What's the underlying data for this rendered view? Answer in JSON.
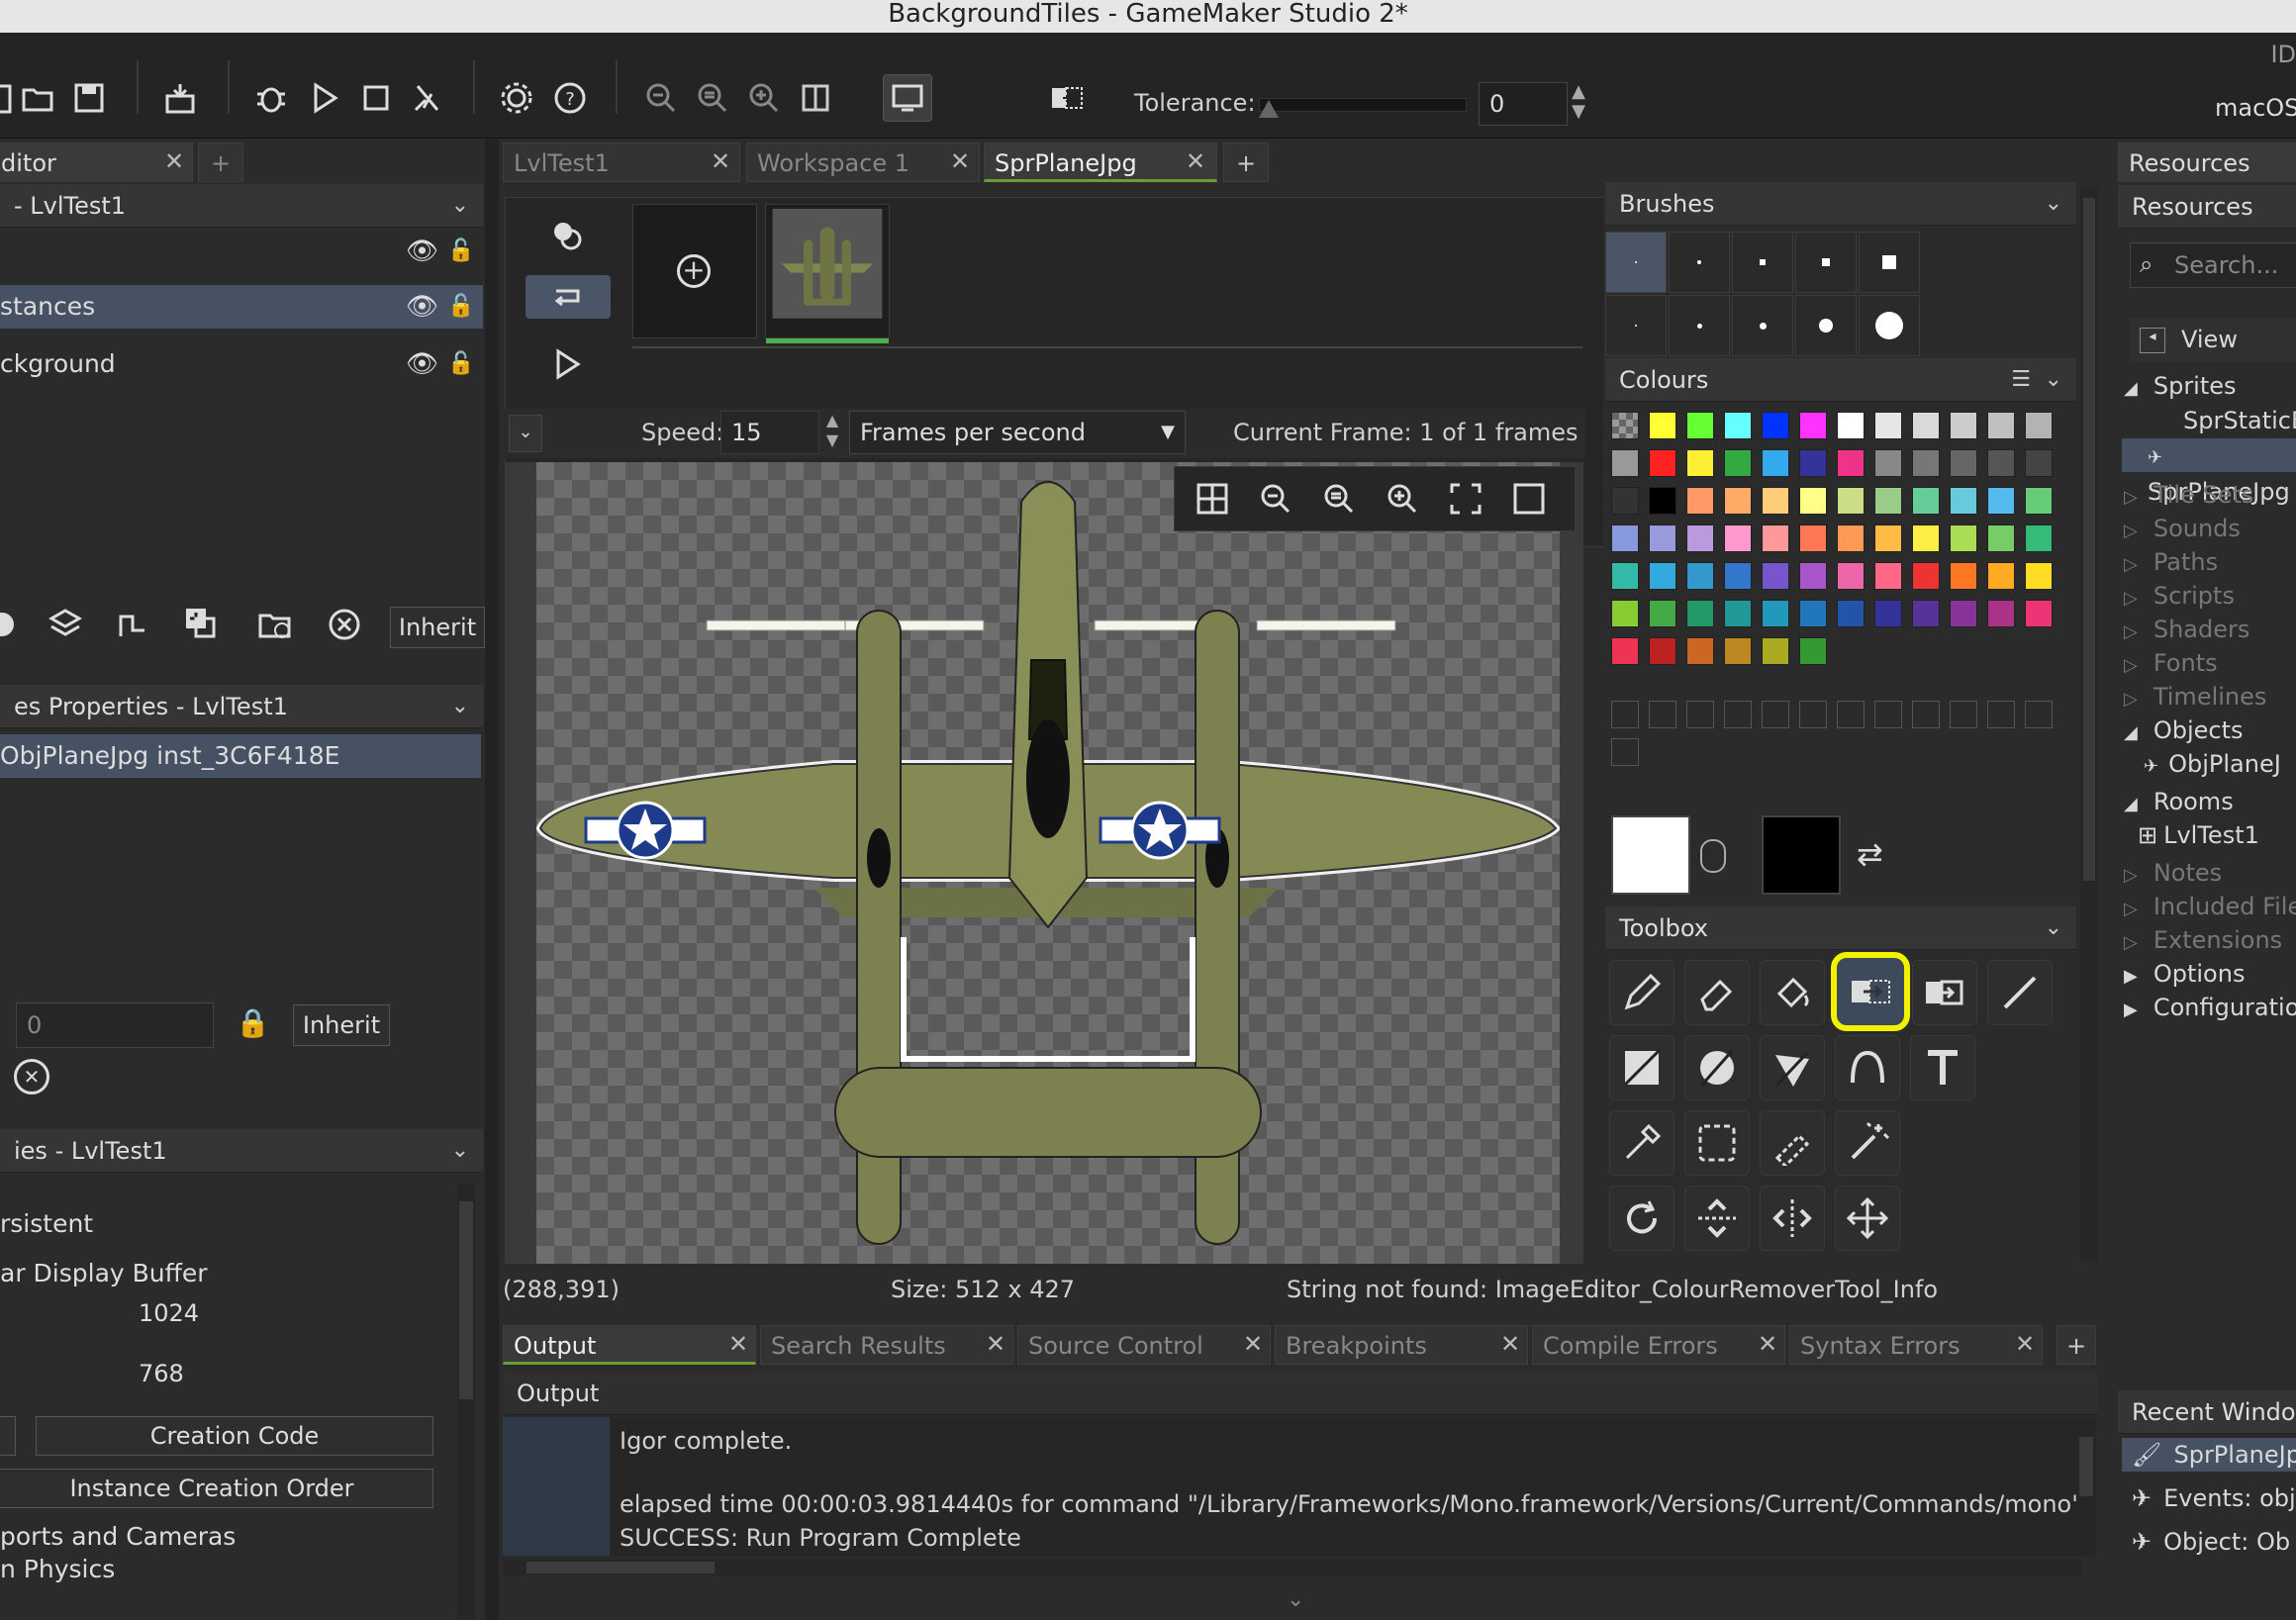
{
  "window": {
    "title": "BackgroundTiles - GameMaker Studio 2*",
    "ide_label": "ID",
    "target_label": "macOS"
  },
  "toolbar": {
    "tolerance_label": "Tolerance:",
    "tolerance_value": "0"
  },
  "left": {
    "editor_tab": "ditor",
    "layers_header": "- LvlTest1",
    "layers": [
      {
        "label": "stances"
      },
      {
        "label": "ckground"
      }
    ],
    "inherit_label": "Inherit",
    "props_header": "es Properties - LvlTest1",
    "instance_row": "ObjPlaneJpg  inst_3C6F418E",
    "depth_value": "0",
    "inherit2_label": "Inherit",
    "room_header": "ies - LvlTest1",
    "persistent_label": "rsistent",
    "clear_buffer_label": "ar Display Buffer",
    "width_value": "1024",
    "height_value": "768",
    "creation_code_label": "Creation Code",
    "instance_order_label": "Instance Creation Order",
    "viewports_label": "ports and Cameras",
    "physics_label": "n Physics"
  },
  "center": {
    "tabs": [
      {
        "label": "LvlTest1"
      },
      {
        "label": "Workspace 1"
      },
      {
        "label": "SprPlaneJpg"
      }
    ],
    "speed_label": "Speed:",
    "speed_value": "15",
    "fps_select": "Frames per second",
    "current_frame": "Current Frame: 1 of 1 frames",
    "status_coords": "(288,391)",
    "status_size": "Size: 512 x 427",
    "status_msg": "String not found: ImageEditor_ColourRemoverTool_Info"
  },
  "right_tools": {
    "brushes_header": "Brushes",
    "colours_header": "Colours",
    "toolbox_header": "Toolbox",
    "palette": [
      "checker",
      "#ffff33",
      "#66ff33",
      "#66ffff",
      "#0033ff",
      "#ff33ff",
      "#ffffff",
      "#e6e6e6",
      "#d9d9d9",
      "#cccccc",
      "#c0c0c0",
      "#b3b3b3",
      "#999999",
      "#ff2222",
      "#ffee33",
      "#33aa44",
      "#33aaee",
      "#333399",
      "#ee3388",
      "#888888",
      "#777777",
      "#666666",
      "#555555",
      "#444444",
      "#333333",
      "#000000",
      "#ff9966",
      "#ffaa66",
      "#ffcc77",
      "#ffff88",
      "#ccdd88",
      "#99cc88",
      "#66cc99",
      "#66ccdd",
      "#55bbee",
      "#66cc77",
      "#8899dd",
      "#9999dd",
      "#bb99dd",
      "#ff99cc",
      "#ff9999",
      "#ff7755",
      "#ff9955",
      "#ffbb44",
      "#ffee44",
      "#aadd55",
      "#77cc66",
      "#33bb77",
      "#33bbaa",
      "#33aadd",
      "#3399cc",
      "#3377cc",
      "#7755cc",
      "#aa55cc",
      "#ee66aa",
      "#ff6688",
      "#ee3333",
      "#ff7722",
      "#ffaa22",
      "#ffdd22",
      "#88cc33",
      "#44aa44",
      "#229966",
      "#229999",
      "#2299bb",
      "#2277bb",
      "#2255aa",
      "#333399",
      "#553399",
      "#883399",
      "#aa3388",
      "#ee3377",
      "#ee3355",
      "#bb2222",
      "#cc6622",
      "#bb8822",
      "#aaaa22",
      "#339933"
    ]
  },
  "resources": {
    "tab": "Resources",
    "header": "Resources",
    "search_placeholder": "Search...",
    "view_label": "View",
    "items": [
      {
        "label": "Sprites"
      },
      {
        "label": "SprStaticB"
      },
      {
        "label": "SprPlaneJpg"
      },
      {
        "label": "Tile Sets"
      },
      {
        "label": "Sounds"
      },
      {
        "label": "Paths"
      },
      {
        "label": "Scripts"
      },
      {
        "label": "Shaders"
      },
      {
        "label": "Fonts"
      },
      {
        "label": "Timelines"
      },
      {
        "label": "Objects"
      },
      {
        "label": "ObjPlaneJ"
      },
      {
        "label": "Rooms"
      },
      {
        "label": "LvlTest1"
      },
      {
        "label": "Notes"
      },
      {
        "label": "Included File"
      },
      {
        "label": "Extensions"
      },
      {
        "label": "Options"
      },
      {
        "label": "Configuratio"
      }
    ],
    "recent_header": "Recent Windo",
    "recent": [
      {
        "label": "SprPlaneJp"
      },
      {
        "label": "Events: obj"
      },
      {
        "label": "Object: Ob"
      }
    ]
  },
  "output": {
    "tabs": [
      {
        "label": "Output"
      },
      {
        "label": "Search Results"
      },
      {
        "label": "Source Control"
      },
      {
        "label": "Breakpoints"
      },
      {
        "label": "Compile Errors"
      },
      {
        "label": "Syntax Errors"
      }
    ],
    "header": "Output",
    "lines": [
      "Igor complete.",
      "elapsed time 00:00:03.9814440s for command \"/Library/Frameworks/Mono.framework/Versions/Current/Commands/mono\" /Users",
      "SUCCESS: Run Program Complete"
    ]
  }
}
